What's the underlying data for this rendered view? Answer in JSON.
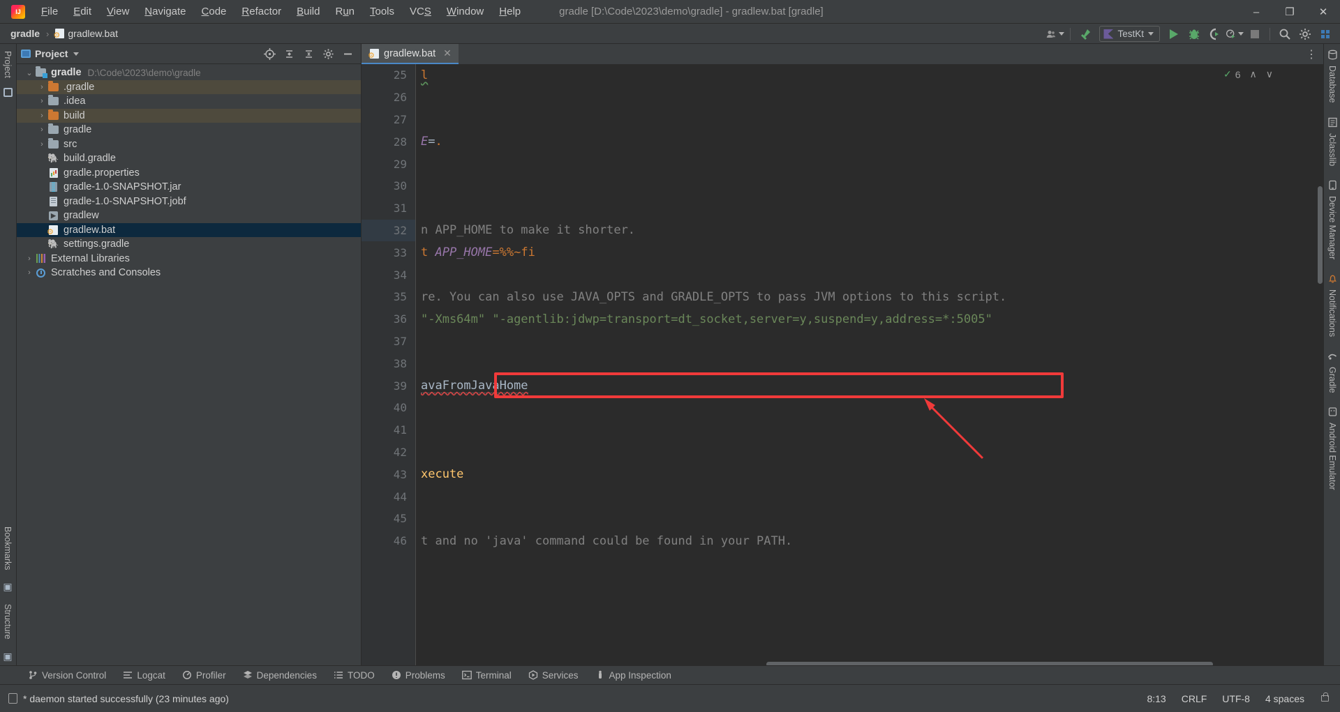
{
  "window": {
    "title": "gradle [D:\\Code\\2023\\demo\\gradle] - gradlew.bat [gradle]",
    "minimize": "–",
    "maximize": "❐",
    "close": "✕"
  },
  "menu": {
    "items": [
      {
        "label": "File"
      },
      {
        "label": "Edit"
      },
      {
        "label": "View"
      },
      {
        "label": "Navigate"
      },
      {
        "label": "Code"
      },
      {
        "label": "Refactor"
      },
      {
        "label": "Build"
      },
      {
        "label": "Run"
      },
      {
        "label": "Tools"
      },
      {
        "label": "VCS"
      },
      {
        "label": "Window"
      },
      {
        "label": "Help"
      }
    ]
  },
  "breadcrumb": {
    "project": "gradle",
    "separator": "›",
    "file": "gradlew.bat"
  },
  "toolbar": {
    "run_config": "TestKt",
    "icons": [
      "user-avatar-icon",
      "build-hammer-icon",
      "run-icon",
      "debug-icon",
      "run-coverage-icon",
      "profiler-icon",
      "stop-icon",
      "search-everywhere-icon",
      "settings-icon",
      "updates-icon"
    ]
  },
  "project_panel": {
    "title": "Project",
    "tree": [
      {
        "label": "gradle",
        "path": "D:\\Code\\2023\\demo\\gradle",
        "icon": "module-folder-icon",
        "arrow": "⌄",
        "depth": 0,
        "bold": true,
        "state": "normal"
      },
      {
        "label": ".gradle",
        "path": "",
        "icon": "folder-orange-icon",
        "arrow": "›",
        "depth": 1,
        "bold": false,
        "state": "modified"
      },
      {
        "label": ".idea",
        "path": "",
        "icon": "folder-icon",
        "arrow": "›",
        "depth": 1,
        "bold": false,
        "state": "normal"
      },
      {
        "label": "build",
        "path": "",
        "icon": "folder-orange-icon",
        "arrow": "›",
        "depth": 1,
        "bold": false,
        "state": "modified"
      },
      {
        "label": "gradle",
        "path": "",
        "icon": "folder-icon",
        "arrow": "›",
        "depth": 1,
        "bold": false,
        "state": "normal"
      },
      {
        "label": "src",
        "path": "",
        "icon": "folder-icon",
        "arrow": "›",
        "depth": 1,
        "bold": false,
        "state": "normal"
      },
      {
        "label": "build.gradle",
        "path": "",
        "icon": "gradle-elephant-icon",
        "arrow": "",
        "depth": 1,
        "bold": false,
        "state": "normal"
      },
      {
        "label": "gradle.properties",
        "path": "",
        "icon": "properties-icon",
        "arrow": "",
        "depth": 1,
        "bold": false,
        "state": "normal"
      },
      {
        "label": "gradle-1.0-SNAPSHOT.jar",
        "path": "",
        "icon": "jar-icon",
        "arrow": "",
        "depth": 1,
        "bold": false,
        "state": "normal"
      },
      {
        "label": "gradle-1.0-SNAPSHOT.jobf",
        "path": "",
        "icon": "document-icon",
        "arrow": "",
        "depth": 1,
        "bold": false,
        "state": "normal"
      },
      {
        "label": "gradlew",
        "path": "",
        "icon": "shell-script-icon",
        "arrow": "",
        "depth": 1,
        "bold": false,
        "state": "normal"
      },
      {
        "label": "gradlew.bat",
        "path": "",
        "icon": "bat-file-icon",
        "arrow": "",
        "depth": 1,
        "bold": false,
        "state": "selected"
      },
      {
        "label": "settings.gradle",
        "path": "",
        "icon": "gradle-elephant-icon",
        "arrow": "",
        "depth": 1,
        "bold": false,
        "state": "normal"
      },
      {
        "label": "External Libraries",
        "path": "",
        "icon": "libraries-icon",
        "arrow": "›",
        "depth": 0,
        "bold": false,
        "state": "normal"
      },
      {
        "label": "Scratches and Consoles",
        "path": "",
        "icon": "scratches-icon",
        "arrow": "›",
        "depth": 0,
        "bold": false,
        "state": "normal"
      }
    ]
  },
  "editor": {
    "tab": {
      "label": "gradlew.bat",
      "close": "✕",
      "icon": "bat-file-icon"
    },
    "inspection_count": "6",
    "inspection_up": "∧",
    "inspection_down": "∨",
    "lines": [
      {
        "num": "25",
        "current": false,
        "segments": [
          {
            "text": "l",
            "cls": "c-num squiggle-green"
          }
        ]
      },
      {
        "num": "26",
        "current": false,
        "segments": []
      },
      {
        "num": "27",
        "current": false,
        "segments": []
      },
      {
        "num": "28",
        "current": false,
        "segments": [
          {
            "text": "E",
            "cls": "c-var"
          },
          {
            "text": "=",
            "cls": "c-plain"
          },
          {
            "text": ".",
            "cls": "c-num"
          }
        ]
      },
      {
        "num": "29",
        "current": false,
        "segments": []
      },
      {
        "num": "30",
        "current": false,
        "segments": []
      },
      {
        "num": "31",
        "current": false,
        "segments": []
      },
      {
        "num": "32",
        "current": true,
        "segments": [
          {
            "text": "n APP_HOME to make it shorter.",
            "cls": "c-comment"
          }
        ]
      },
      {
        "num": "33",
        "current": false,
        "segments": [
          {
            "text": "t ",
            "cls": "c-kw"
          },
          {
            "text": "APP_HOME",
            "cls": "c-var"
          },
          {
            "text": "=",
            "cls": "c-kw"
          },
          {
            "text": "%%~fi",
            "cls": "c-num"
          }
        ]
      },
      {
        "num": "34",
        "current": false,
        "segments": []
      },
      {
        "num": "35",
        "current": false,
        "segments": [
          {
            "text": "re. You can also use JAVA_OPTS and GRADLE_OPTS to pass JVM options to this script.",
            "cls": "c-comment"
          }
        ]
      },
      {
        "num": "36",
        "current": false,
        "segments": [
          {
            "text": "\"-Xms64m\" ",
            "cls": "c-str"
          },
          {
            "text": "\"-agentlib:jdwp=transport=dt_socket,server=y,suspend=y,address=*:5005\"",
            "cls": "c-str"
          }
        ]
      },
      {
        "num": "37",
        "current": false,
        "segments": []
      },
      {
        "num": "38",
        "current": false,
        "segments": []
      },
      {
        "num": "39",
        "current": false,
        "segments": [
          {
            "text": "avaFromJavaHome",
            "cls": "c-label squiggle-red"
          }
        ]
      },
      {
        "num": "40",
        "current": false,
        "segments": []
      },
      {
        "num": "41",
        "current": false,
        "segments": []
      },
      {
        "num": "42",
        "current": false,
        "segments": []
      },
      {
        "num": "43",
        "current": false,
        "segments": [
          {
            "text": "xecute",
            "cls": "c-yellow"
          }
        ]
      },
      {
        "num": "44",
        "current": false,
        "segments": []
      },
      {
        "num": "45",
        "current": false,
        "segments": []
      },
      {
        "num": "46",
        "current": false,
        "segments": [
          {
            "text": "t and no ",
            "cls": "c-comment"
          },
          {
            "text": "'java' ",
            "cls": "c-comment"
          },
          {
            "text": "command could be found in your PATH.",
            "cls": "c-comment"
          }
        ]
      }
    ],
    "annotation": {
      "type": "red-arrow-annotation",
      "color": "#f03a3a"
    }
  },
  "right_stripe": {
    "items": [
      {
        "label": "Database",
        "icon": "database-icon"
      },
      {
        "label": "Jclasslib",
        "icon": "jclasslib-icon"
      },
      {
        "label": "Device Manager",
        "icon": "device-manager-icon"
      },
      {
        "label": "Notifications",
        "icon": "notifications-icon"
      },
      {
        "label": "Gradle",
        "icon": "gradle-icon"
      },
      {
        "label": "Android Emulator",
        "icon": "android-emulator-icon"
      }
    ]
  },
  "left_stripe": {
    "items": [
      {
        "label": "Project",
        "icon": "project-icon"
      },
      {
        "label": "Bookmarks",
        "icon": "bookmarks-icon"
      },
      {
        "label": "Structure",
        "icon": "structure-icon"
      }
    ]
  },
  "tool_windows": {
    "items": [
      {
        "label": "Version Control",
        "icon": "vcs-branch-icon"
      },
      {
        "label": "Logcat",
        "icon": "logcat-icon"
      },
      {
        "label": "Profiler",
        "icon": "profiler-icon"
      },
      {
        "label": "Dependencies",
        "icon": "dependencies-icon"
      },
      {
        "label": "TODO",
        "icon": "todo-list-icon"
      },
      {
        "label": "Problems",
        "icon": "problems-icon"
      },
      {
        "label": "Terminal",
        "icon": "terminal-icon"
      },
      {
        "label": "Services",
        "icon": "services-icon"
      },
      {
        "label": "App Inspection",
        "icon": "app-inspection-icon"
      }
    ]
  },
  "status_bar": {
    "message": "* daemon started successfully (23 minutes ago)",
    "caret_position": "8:13",
    "line_separator": "CRLF",
    "encoding": "UTF-8",
    "indent": "4 spaces"
  }
}
